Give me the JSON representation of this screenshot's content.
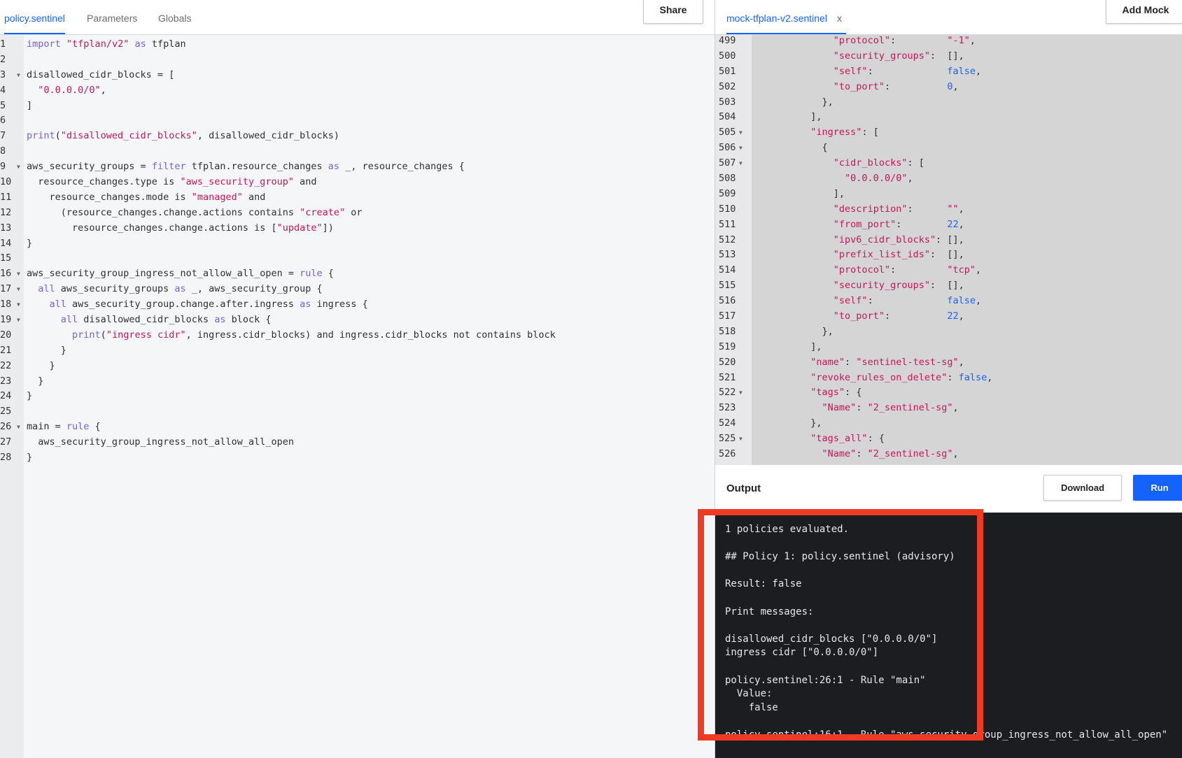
{
  "left_tabs": [
    "policy.sentinel",
    "Parameters",
    "Globals"
  ],
  "share_label": "Share",
  "policy_lines": [
    {
      "n": "1",
      "fold": false,
      "html": "<span class='k'>import</span> <span class='s'>\"tfplan/v2\"</span> <span class='k'>as</span> tfplan"
    },
    {
      "n": "2",
      "fold": false,
      "html": ""
    },
    {
      "n": "3",
      "fold": true,
      "html": "disallowed_cidr_blocks = ["
    },
    {
      "n": "4",
      "fold": false,
      "html": "  <span class='s'>\"0.0.0.0/0\"</span>,"
    },
    {
      "n": "5",
      "fold": false,
      "html": "]"
    },
    {
      "n": "6",
      "fold": false,
      "html": ""
    },
    {
      "n": "7",
      "fold": false,
      "html": "<span class='k'>print</span>(<span class='s'>\"disallowed_cidr_blocks\"</span>, disallowed_cidr_blocks)"
    },
    {
      "n": "8",
      "fold": false,
      "html": ""
    },
    {
      "n": "9",
      "fold": true,
      "html": "aws_security_groups = <span class='k'>filter</span> tfplan.resource_changes <span class='k'>as</span> _, resource_changes {"
    },
    {
      "n": "10",
      "fold": false,
      "html": "  resource_changes.type is <span class='s'>\"aws_security_group\"</span> and"
    },
    {
      "n": "11",
      "fold": false,
      "html": "    resource_changes.mode is <span class='s'>\"managed\"</span> and"
    },
    {
      "n": "12",
      "fold": false,
      "html": "      (resource_changes.change.actions contains <span class='s'>\"create\"</span> or"
    },
    {
      "n": "13",
      "fold": false,
      "html": "        resource_changes.change.actions is [<span class='s'>\"update\"</span>])"
    },
    {
      "n": "14",
      "fold": false,
      "html": "}"
    },
    {
      "n": "15",
      "fold": false,
      "html": ""
    },
    {
      "n": "16",
      "fold": true,
      "html": "aws_security_group_ingress_not_allow_all_open = <span class='k'>rule</span> {"
    },
    {
      "n": "17",
      "fold": true,
      "html": "  <span class='k'>all</span> aws_security_groups <span class='k'>as</span> _, aws_security_group {"
    },
    {
      "n": "18",
      "fold": true,
      "html": "    <span class='k'>all</span> aws_security_group.change.after.ingress <span class='k'>as</span> ingress {"
    },
    {
      "n": "19",
      "fold": true,
      "html": "      <span class='k'>all</span> disallowed_cidr_blocks <span class='k'>as</span> block {"
    },
    {
      "n": "20",
      "fold": false,
      "html": "        <span class='k'>print</span>(<span class='s'>\"ingress cidr\"</span>, ingress.cidr_blocks) and ingress.cidr_blocks not contains block"
    },
    {
      "n": "21",
      "fold": false,
      "html": "      }"
    },
    {
      "n": "22",
      "fold": false,
      "html": "    }"
    },
    {
      "n": "23",
      "fold": false,
      "html": "  }"
    },
    {
      "n": "24",
      "fold": false,
      "html": "}"
    },
    {
      "n": "25",
      "fold": false,
      "html": ""
    },
    {
      "n": "26",
      "fold": true,
      "html": "main = <span class='k'>rule</span> {"
    },
    {
      "n": "27",
      "fold": false,
      "html": "  aws_security_group_ingress_not_allow_all_open"
    },
    {
      "n": "28",
      "fold": false,
      "html": "}"
    }
  ],
  "mock_tab_label": "mock-tfplan-v2.sentinel",
  "mock_tab_close": "x",
  "add_mock_label": "Add Mock",
  "mock_lines": [
    {
      "n": "499",
      "fold": false,
      "html": "              <span class='s'>\"protocol\"</span>:         <span class='s'>\"-1\"</span>,"
    },
    {
      "n": "500",
      "fold": false,
      "html": "              <span class='s'>\"security_groups\"</span>:  [],"
    },
    {
      "n": "501",
      "fold": false,
      "html": "              <span class='s'>\"self\"</span>:             <span class='n'>false</span>,"
    },
    {
      "n": "502",
      "fold": false,
      "html": "              <span class='s'>\"to_port\"</span>:          <span class='n'>0</span>,"
    },
    {
      "n": "503",
      "fold": false,
      "html": "            },"
    },
    {
      "n": "504",
      "fold": false,
      "html": "          ],"
    },
    {
      "n": "505",
      "fold": true,
      "html": "          <span class='s'>\"ingress\"</span>: ["
    },
    {
      "n": "506",
      "fold": true,
      "html": "            {"
    },
    {
      "n": "507",
      "fold": true,
      "html": "              <span class='s'>\"cidr_blocks\"</span>: ["
    },
    {
      "n": "508",
      "fold": false,
      "html": "                <span class='s'>\"0.0.0.0/0\"</span>,"
    },
    {
      "n": "509",
      "fold": false,
      "html": "              ],"
    },
    {
      "n": "510",
      "fold": false,
      "html": "              <span class='s'>\"description\"</span>:      <span class='s'>\"\"</span>,"
    },
    {
      "n": "511",
      "fold": false,
      "html": "              <span class='s'>\"from_port\"</span>:        <span class='n'>22</span>,"
    },
    {
      "n": "512",
      "fold": false,
      "html": "              <span class='s'>\"ipv6_cidr_blocks\"</span>: [],"
    },
    {
      "n": "513",
      "fold": false,
      "html": "              <span class='s'>\"prefix_list_ids\"</span>:  [],"
    },
    {
      "n": "514",
      "fold": false,
      "html": "              <span class='s'>\"protocol\"</span>:         <span class='s'>\"tcp\"</span>,"
    },
    {
      "n": "515",
      "fold": false,
      "html": "              <span class='s'>\"security_groups\"</span>:  [],"
    },
    {
      "n": "516",
      "fold": false,
      "html": "              <span class='s'>\"self\"</span>:             <span class='n'>false</span>,"
    },
    {
      "n": "517",
      "fold": false,
      "html": "              <span class='s'>\"to_port\"</span>:          <span class='n'>22</span>,"
    },
    {
      "n": "518",
      "fold": false,
      "html": "            },"
    },
    {
      "n": "519",
      "fold": false,
      "html": "          ],"
    },
    {
      "n": "520",
      "fold": false,
      "html": "          <span class='s'>\"name\"</span>: <span class='s'>\"sentinel-test-sg\"</span>,"
    },
    {
      "n": "521",
      "fold": false,
      "html": "          <span class='s'>\"revoke_rules_on_delete\"</span>: <span class='n'>false</span>,"
    },
    {
      "n": "522",
      "fold": true,
      "html": "          <span class='s'>\"tags\"</span>: {"
    },
    {
      "n": "523",
      "fold": false,
      "html": "            <span class='s'>\"Name\"</span>: <span class='s'>\"2_sentinel-sg\"</span>,"
    },
    {
      "n": "524",
      "fold": false,
      "html": "          },"
    },
    {
      "n": "525",
      "fold": true,
      "html": "          <span class='s'>\"tags_all\"</span>: {"
    },
    {
      "n": "526",
      "fold": false,
      "html": "            <span class='s'>\"Name\"</span>: <span class='s'>\"2_sentinel-sg\"</span>,"
    }
  ],
  "output_title": "Output",
  "download_label": "Download",
  "run_label": "Run",
  "output_lines": [
    "1 policies evaluated.",
    "",
    "## Policy 1: policy.sentinel (advisory)",
    "",
    "Result: false",
    "",
    "Print messages:",
    "",
    "disallowed_cidr_blocks [\"0.0.0.0/0\"]",
    "ingress cidr [\"0.0.0.0/0\"]",
    "",
    "policy.sentinel:26:1 - Rule \"main\"",
    "  Value:",
    "    false",
    "",
    "policy.sentinel:16:1 - Rule \"aws_security_group_ingress_not_allow_all_open\""
  ],
  "colors": {
    "accent": "#1563ff",
    "highlight": "#ef3b24",
    "terminal_bg": "#1c1d21",
    "keyword": "#7a60d9",
    "string": "#c2185b"
  }
}
